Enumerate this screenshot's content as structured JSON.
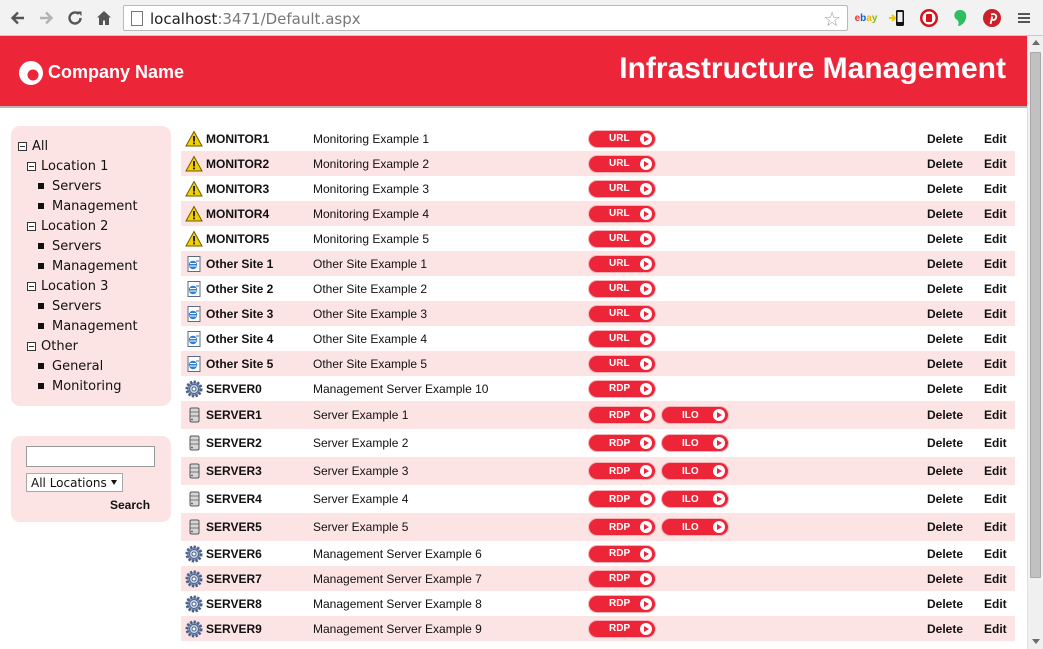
{
  "browser": {
    "url_host": "localhost",
    "url_path": ":3471/Default.aspx"
  },
  "header": {
    "company_name": "Company Name",
    "app_title": "Infrastructure Management"
  },
  "tree": {
    "root": "All",
    "locations": [
      {
        "label": "Location 1",
        "children": [
          "Servers",
          "Management"
        ]
      },
      {
        "label": "Location 2",
        "children": [
          "Servers",
          "Management"
        ]
      },
      {
        "label": "Location 3",
        "children": [
          "Servers",
          "Management"
        ]
      },
      {
        "label": "Other",
        "children": [
          "General",
          "Monitoring"
        ]
      }
    ]
  },
  "search": {
    "input_value": "",
    "location_select": "All Locations",
    "button_label": "Search"
  },
  "actions": {
    "delete": "Delete",
    "edit": "Edit"
  },
  "colors": {
    "brand": "#ec2539",
    "row_alt": "#fde4e4"
  },
  "rows": [
    {
      "name": "MONITOR1",
      "description": "Monitoring Example 1",
      "icon": "warning-icon",
      "buttons": [
        "URL"
      ]
    },
    {
      "name": "MONITOR2",
      "description": "Monitoring Example 2",
      "icon": "warning-icon",
      "buttons": [
        "URL"
      ]
    },
    {
      "name": "MONITOR3",
      "description": "Monitoring Example 3",
      "icon": "warning-icon",
      "buttons": [
        "URL"
      ]
    },
    {
      "name": "MONITOR4",
      "description": "Monitoring Example 4",
      "icon": "warning-icon",
      "buttons": [
        "URL"
      ]
    },
    {
      "name": "MONITOR5",
      "description": "Monitoring Example 5",
      "icon": "warning-icon",
      "buttons": [
        "URL"
      ]
    },
    {
      "name": "Other Site 1",
      "description": "Other Site Example 1",
      "icon": "web-page-icon",
      "buttons": [
        "URL"
      ]
    },
    {
      "name": "Other Site 2",
      "description": "Other Site Example 2",
      "icon": "web-page-icon",
      "buttons": [
        "URL"
      ]
    },
    {
      "name": "Other Site 3",
      "description": "Other Site Example 3",
      "icon": "web-page-icon",
      "buttons": [
        "URL"
      ]
    },
    {
      "name": "Other Site 4",
      "description": "Other Site Example 4",
      "icon": "web-page-icon",
      "buttons": [
        "URL"
      ]
    },
    {
      "name": "Other Site 5",
      "description": "Other Site Example 5",
      "icon": "web-page-icon",
      "buttons": [
        "URL"
      ]
    },
    {
      "name": "SERVER0",
      "description": "Management Server Example 10",
      "icon": "gear-icon",
      "buttons": [
        "RDP"
      ]
    },
    {
      "name": "SERVER1",
      "description": "Server Example 1",
      "icon": "server-icon",
      "buttons": [
        "RDP",
        "ILO"
      ]
    },
    {
      "name": "SERVER2",
      "description": "Server Example 2",
      "icon": "server-icon",
      "buttons": [
        "RDP",
        "ILO"
      ]
    },
    {
      "name": "SERVER3",
      "description": "Server Example 3",
      "icon": "server-icon",
      "buttons": [
        "RDP",
        "ILO"
      ]
    },
    {
      "name": "SERVER4",
      "description": "Server Example 4",
      "icon": "server-icon",
      "buttons": [
        "RDP",
        "ILO"
      ]
    },
    {
      "name": "SERVER5",
      "description": "Server Example 5",
      "icon": "server-icon",
      "buttons": [
        "RDP",
        "ILO"
      ]
    },
    {
      "name": "SERVER6",
      "description": "Management Server Example 6",
      "icon": "gear-icon",
      "buttons": [
        "RDP"
      ]
    },
    {
      "name": "SERVER7",
      "description": "Management Server Example 7",
      "icon": "gear-icon",
      "buttons": [
        "RDP"
      ]
    },
    {
      "name": "SERVER8",
      "description": "Management Server Example 8",
      "icon": "gear-icon",
      "buttons": [
        "RDP"
      ]
    },
    {
      "name": "SERVER9",
      "description": "Management Server Example 9",
      "icon": "gear-icon",
      "buttons": [
        "RDP"
      ]
    }
  ]
}
